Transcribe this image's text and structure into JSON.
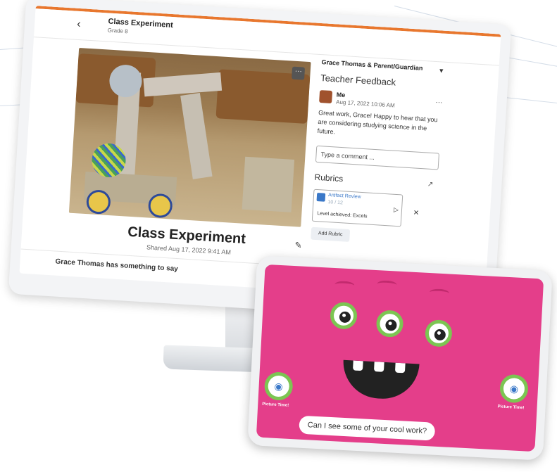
{
  "header": {
    "back_icon": "chevron-left-icon",
    "title": "Class Experiment",
    "subtitle": "Grade 8"
  },
  "post": {
    "title": "Class Experiment",
    "shared": "Shared Aug 17, 2022 9:41 AM",
    "say": "Grace Thomas has something to say"
  },
  "side": {
    "audience": "Grace Thomas & Parent/Guardian",
    "feedback_heading": "Teacher Feedback",
    "comment": {
      "author": "Me",
      "time": "Aug 17, 2022 10:06 AM",
      "text": "Great work, Grace! Happy to hear that you are considering studying science in the future."
    },
    "comment_placeholder": "Type a comment ...",
    "rubrics_heading": "Rubrics",
    "rubric": {
      "name": "Artifact Review",
      "score": "10 / 12",
      "level": "Level achieved: Excels"
    },
    "add_rubric": "Add Rubric"
  },
  "tablet": {
    "camera_label_left": "Picture Time!",
    "camera_label_right": "Picture Time!",
    "bubble": "Can I see some of your cool work?"
  },
  "colors": {
    "accent_orange": "#e8772e",
    "tablet_pink": "#e43e8a",
    "monster_green": "#7cc552"
  }
}
